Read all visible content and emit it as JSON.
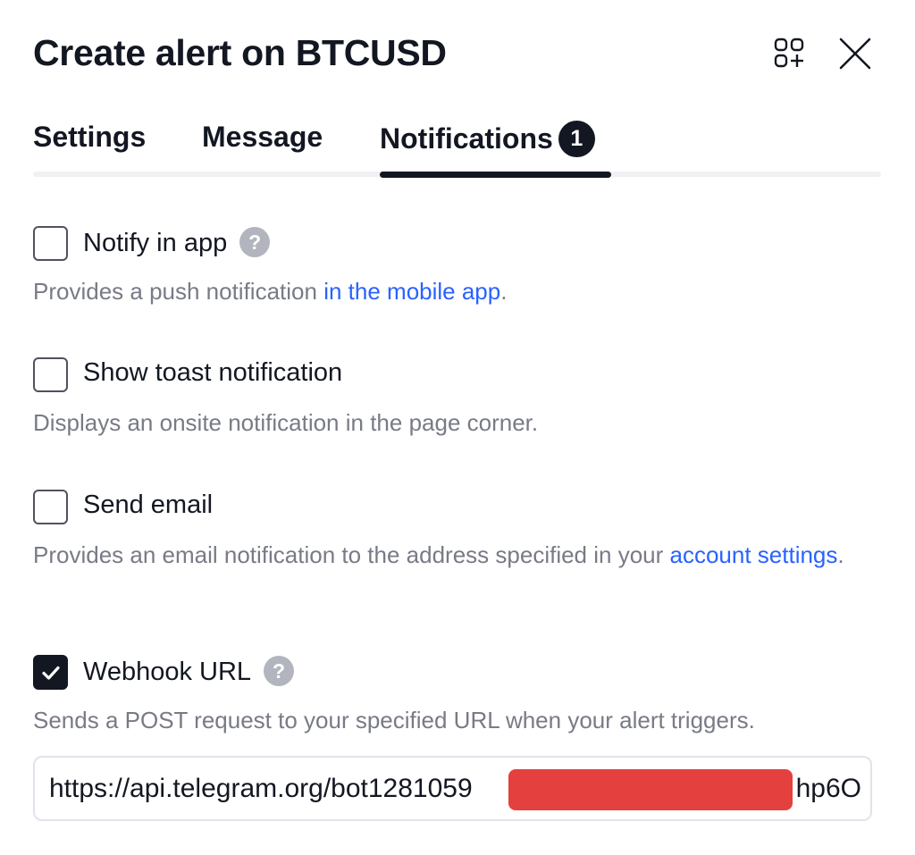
{
  "dialog": {
    "title": "Create alert on BTCUSD",
    "icons": {
      "templates": "templates-icon",
      "close": "close-icon"
    }
  },
  "tabs": [
    {
      "label": "Settings",
      "active": false
    },
    {
      "label": "Message",
      "active": false
    },
    {
      "label": "Notifications",
      "active": true,
      "badge": "1"
    }
  ],
  "options": {
    "notify_app": {
      "label": "Notify in app",
      "checked": false,
      "help": "?",
      "desc_prefix": "Provides a push notification ",
      "desc_link": "in the mobile app",
      "desc_suffix": "."
    },
    "toast": {
      "label": "Show toast notification",
      "checked": false,
      "desc": "Displays an onsite notification in the page corner."
    },
    "email": {
      "label": "Send email",
      "checked": false,
      "desc_prefix": "Provides an email notification to the address specified in your ",
      "desc_link": "account settings",
      "desc_suffix": "."
    },
    "webhook": {
      "label": "Webhook URL",
      "checked": true,
      "help": "?",
      "desc": "Sends a POST request to your specified URL when your alert triggers.",
      "url_visible_start": "https://api.telegram.org/bot1281059",
      "url_visible_end": "hp6O"
    }
  },
  "colors": {
    "text_primary": "#131722",
    "text_secondary": "#787b86",
    "link": "#2962ff",
    "redaction": "#e4403e"
  }
}
